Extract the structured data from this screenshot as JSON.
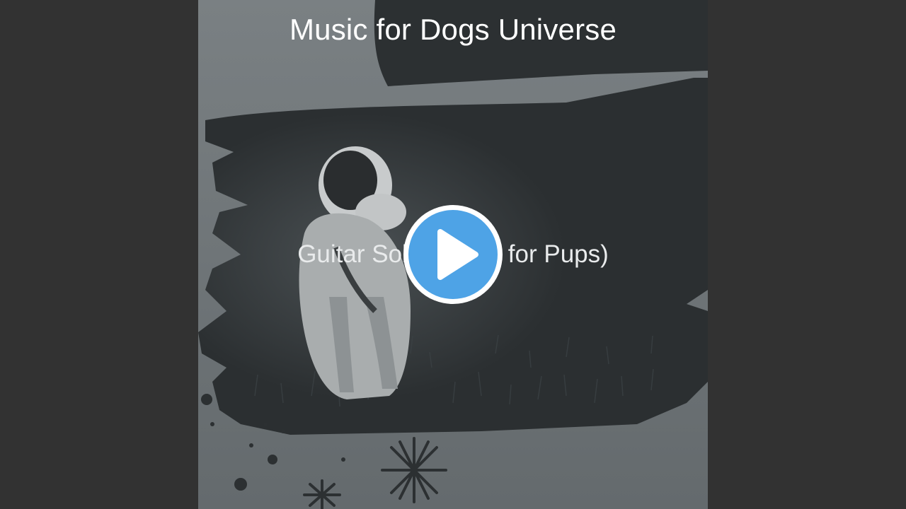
{
  "video": {
    "channel_title": "Music for Dogs Universe",
    "track_title": "Guitar Solo (Music for Pups)",
    "play_icon": "play-icon"
  },
  "colors": {
    "page_background": "#323232",
    "artwork_background": "#6b7174",
    "brush_dark": "#2c3032",
    "play_fill": "#4ea3e6",
    "play_ring": "#ffffff"
  }
}
